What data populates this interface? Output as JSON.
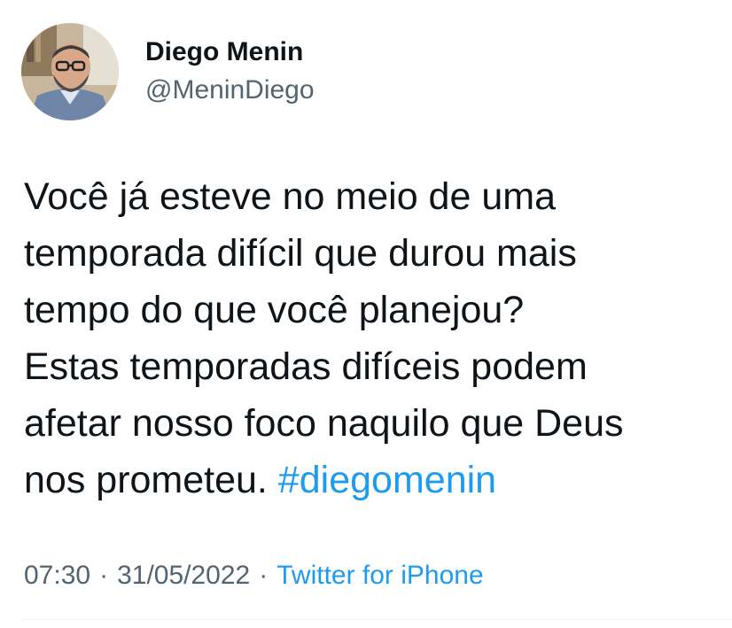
{
  "author": {
    "name": "Diego Menin",
    "handle": "@MeninDiego"
  },
  "tweet": {
    "lines": [
      "Você já esteve no meio de uma",
      "temporada difícil que durou mais",
      "tempo do que você planejou?",
      "Estas temporadas difíceis podem",
      "afetar nosso foco naquilo que Deus",
      "nos prometeu."
    ],
    "hashtag": "#diegomenin"
  },
  "meta": {
    "time": "07:30",
    "separator": "·",
    "date": "31/05/2022",
    "source": "Twitter for iPhone"
  },
  "colors": {
    "text": "#0f1419",
    "secondary": "#536471",
    "link": "#1d9bf0"
  },
  "icons": {
    "avatar": "profile-photo"
  }
}
